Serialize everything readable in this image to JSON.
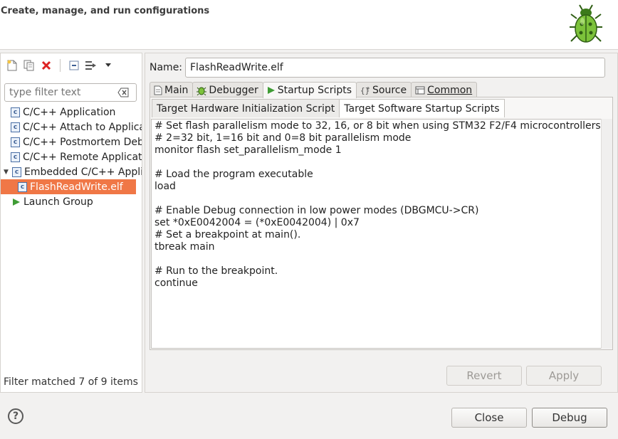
{
  "header": {
    "title": "Create, manage, and run configurations"
  },
  "left": {
    "filter_placeholder": "type filter text",
    "tree": [
      {
        "label": "C/C++ Application",
        "level": 0,
        "icon": "c-config-icon"
      },
      {
        "label": "C/C++ Attach to Applica",
        "level": 0,
        "icon": "c-config-icon"
      },
      {
        "label": "C/C++ Postmortem Debu",
        "level": 0,
        "icon": "c-config-icon"
      },
      {
        "label": "C/C++ Remote Applicatio",
        "level": 0,
        "icon": "c-config-icon"
      },
      {
        "label": "Embedded C/C++ Applic",
        "level": 0,
        "icon": "c-config-icon",
        "expanded": true
      },
      {
        "label": "FlashReadWrite.elf",
        "level": 1,
        "icon": "c-config-icon",
        "selected": true
      },
      {
        "label": "Launch Group",
        "level": 0,
        "icon": "launch-group-icon"
      }
    ],
    "status": "Filter matched 7 of 9 items"
  },
  "right": {
    "name_label": "Name:",
    "name_value": "FlashReadWrite.elf",
    "tabs": [
      "Main",
      "Debugger",
      "Startup Scripts",
      "Source",
      "Common"
    ],
    "active_tab": "Startup Scripts",
    "subtabs": [
      "Target Hardware Initialization Script",
      "Target Software Startup Scripts"
    ],
    "script_lines": [
      "# Set flash parallelism mode to 32, 16, or 8 bit when using STM32 F2/F4 microcontrollers",
      "# 2=32 bit, 1=16 bit and 0=8 bit parallelism mode",
      "monitor flash set_parallelism_mode 1",
      "",
      "# Load the program executable",
      "load",
      "",
      "# Enable Debug connection in low power modes (DBGMCU->CR)",
      "set *0xE0042004 = (*0xE0042004) | 0x7",
      "# Set a breakpoint at main().",
      "tbreak main",
      "",
      "# Run to the breakpoint.",
      "continue"
    ],
    "revert_label": "Revert",
    "apply_label": "Apply"
  },
  "footer": {
    "help_label": "?",
    "close_label": "Close",
    "debug_label": "Debug"
  }
}
